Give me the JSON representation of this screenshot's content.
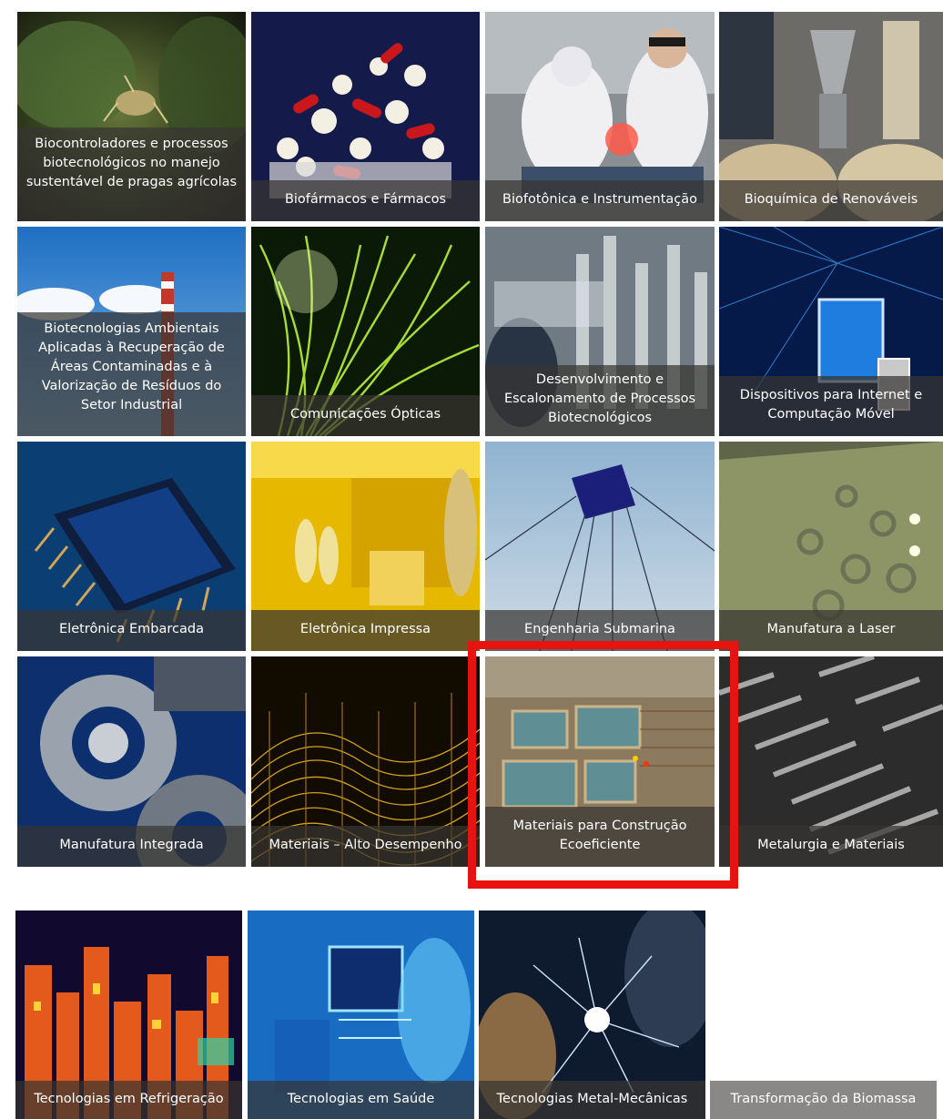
{
  "tiles": [
    {
      "label": "Biocontroladores e processos biotecnológicos no manejo sustentável de pragas agrícolas",
      "theme": "insect-on-leaf"
    },
    {
      "label": "Biofármacos e Fármacos",
      "theme": "pills"
    },
    {
      "label": "Biofotônica e Instrumentação",
      "theme": "laser-surgery"
    },
    {
      "label": "Bioquímica de Renováveis",
      "theme": "lab-reactor"
    },
    {
      "label": "Biotecnologias Ambientais Aplicadas à Recuperação de Áreas Contaminadas e à Valorização de Resíduos do Setor Industrial",
      "theme": "industrial-chimney"
    },
    {
      "label": "Comunicações Ópticas",
      "theme": "optical-fibers"
    },
    {
      "label": "Desenvolvimento e Escalonamento de Processos Biotecnológicos",
      "theme": "lab-pipes"
    },
    {
      "label": "Dispositivos para Internet e Computação Móvel",
      "theme": "mobile-devices"
    },
    {
      "label": "Eletrônica Embarcada",
      "theme": "microchip"
    },
    {
      "label": "Eletrônica Impressa",
      "theme": "cleanroom"
    },
    {
      "label": "Engenharia Submarina",
      "theme": "subsea-structure"
    },
    {
      "label": "Manufatura a Laser",
      "theme": "laser-cutting"
    },
    {
      "label": "Manufatura Integrada",
      "theme": "gears"
    },
    {
      "label": "Materiais – Alto Desempenho",
      "theme": "graphene-mesh"
    },
    {
      "label": "Materiais para Construção Ecoeficiente",
      "theme": "construction-site"
    },
    {
      "label": "Metalurgia e Materiais",
      "theme": "metal-fins"
    },
    {
      "label": "Tecnologias em Refrigeração",
      "theme": "thermal-city"
    },
    {
      "label": "Tecnologias em Saúde",
      "theme": "medical-equipment"
    },
    {
      "label": "Tecnologias Metal-Mecânicas",
      "theme": "welding"
    },
    {
      "label": "Transformação da Biomassa",
      "theme": "none"
    }
  ],
  "selected_tile_index": 14,
  "colors": {
    "highlight_border": "#e8130f",
    "caption_bg": "rgba(55,52,50,0.72)",
    "caption_text": "#ffffff"
  }
}
